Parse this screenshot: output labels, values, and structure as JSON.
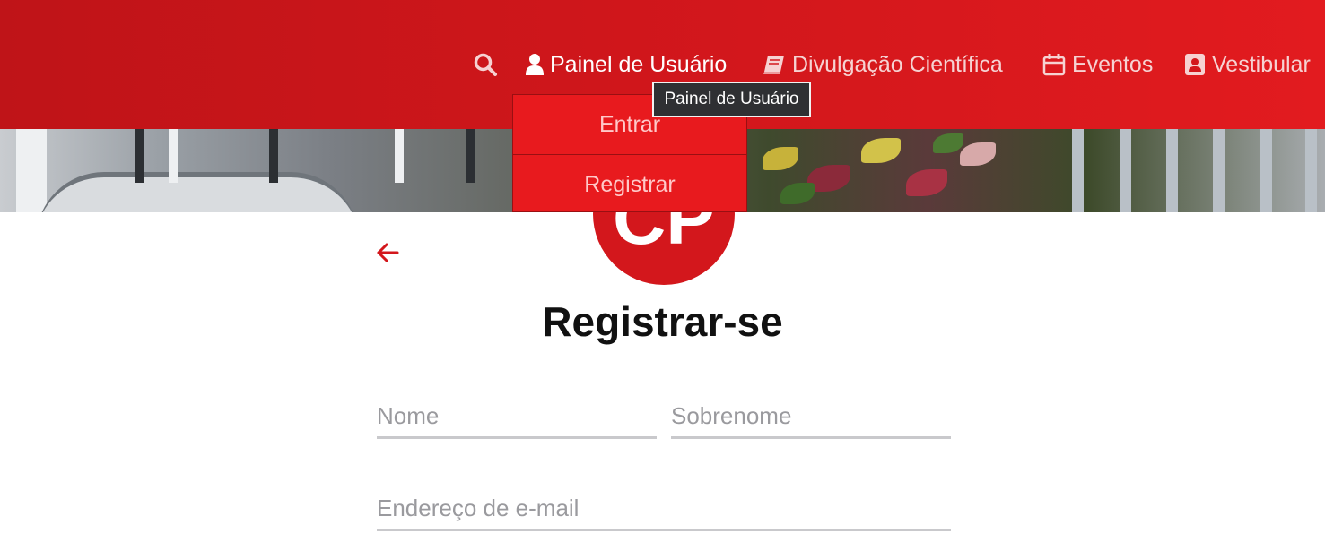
{
  "nav": {
    "items": [
      {
        "label": "Painel de Usuário",
        "icon": "user-icon",
        "active": true
      },
      {
        "label": "Divulgação Científica",
        "icon": "book-icon"
      },
      {
        "label": "Eventos",
        "icon": "calendar-icon"
      },
      {
        "label": "Vestibular",
        "icon": "contact-card-icon"
      }
    ],
    "search_icon": "search-icon"
  },
  "dropdown": {
    "items": [
      {
        "label": "Entrar"
      },
      {
        "label": "Registrar"
      }
    ]
  },
  "tooltip": {
    "text": "Painel de Usuário"
  },
  "logo": {
    "text": "CP"
  },
  "form": {
    "title": "Registrar-se",
    "first_name_placeholder": "Nome",
    "last_name_placeholder": "Sobrenome",
    "email_placeholder": "Endereço de e-mail"
  },
  "colors": {
    "brand_red": "#d3171c",
    "menu_red": "#e81a1e",
    "underline_gray": "#c9c9cc"
  }
}
